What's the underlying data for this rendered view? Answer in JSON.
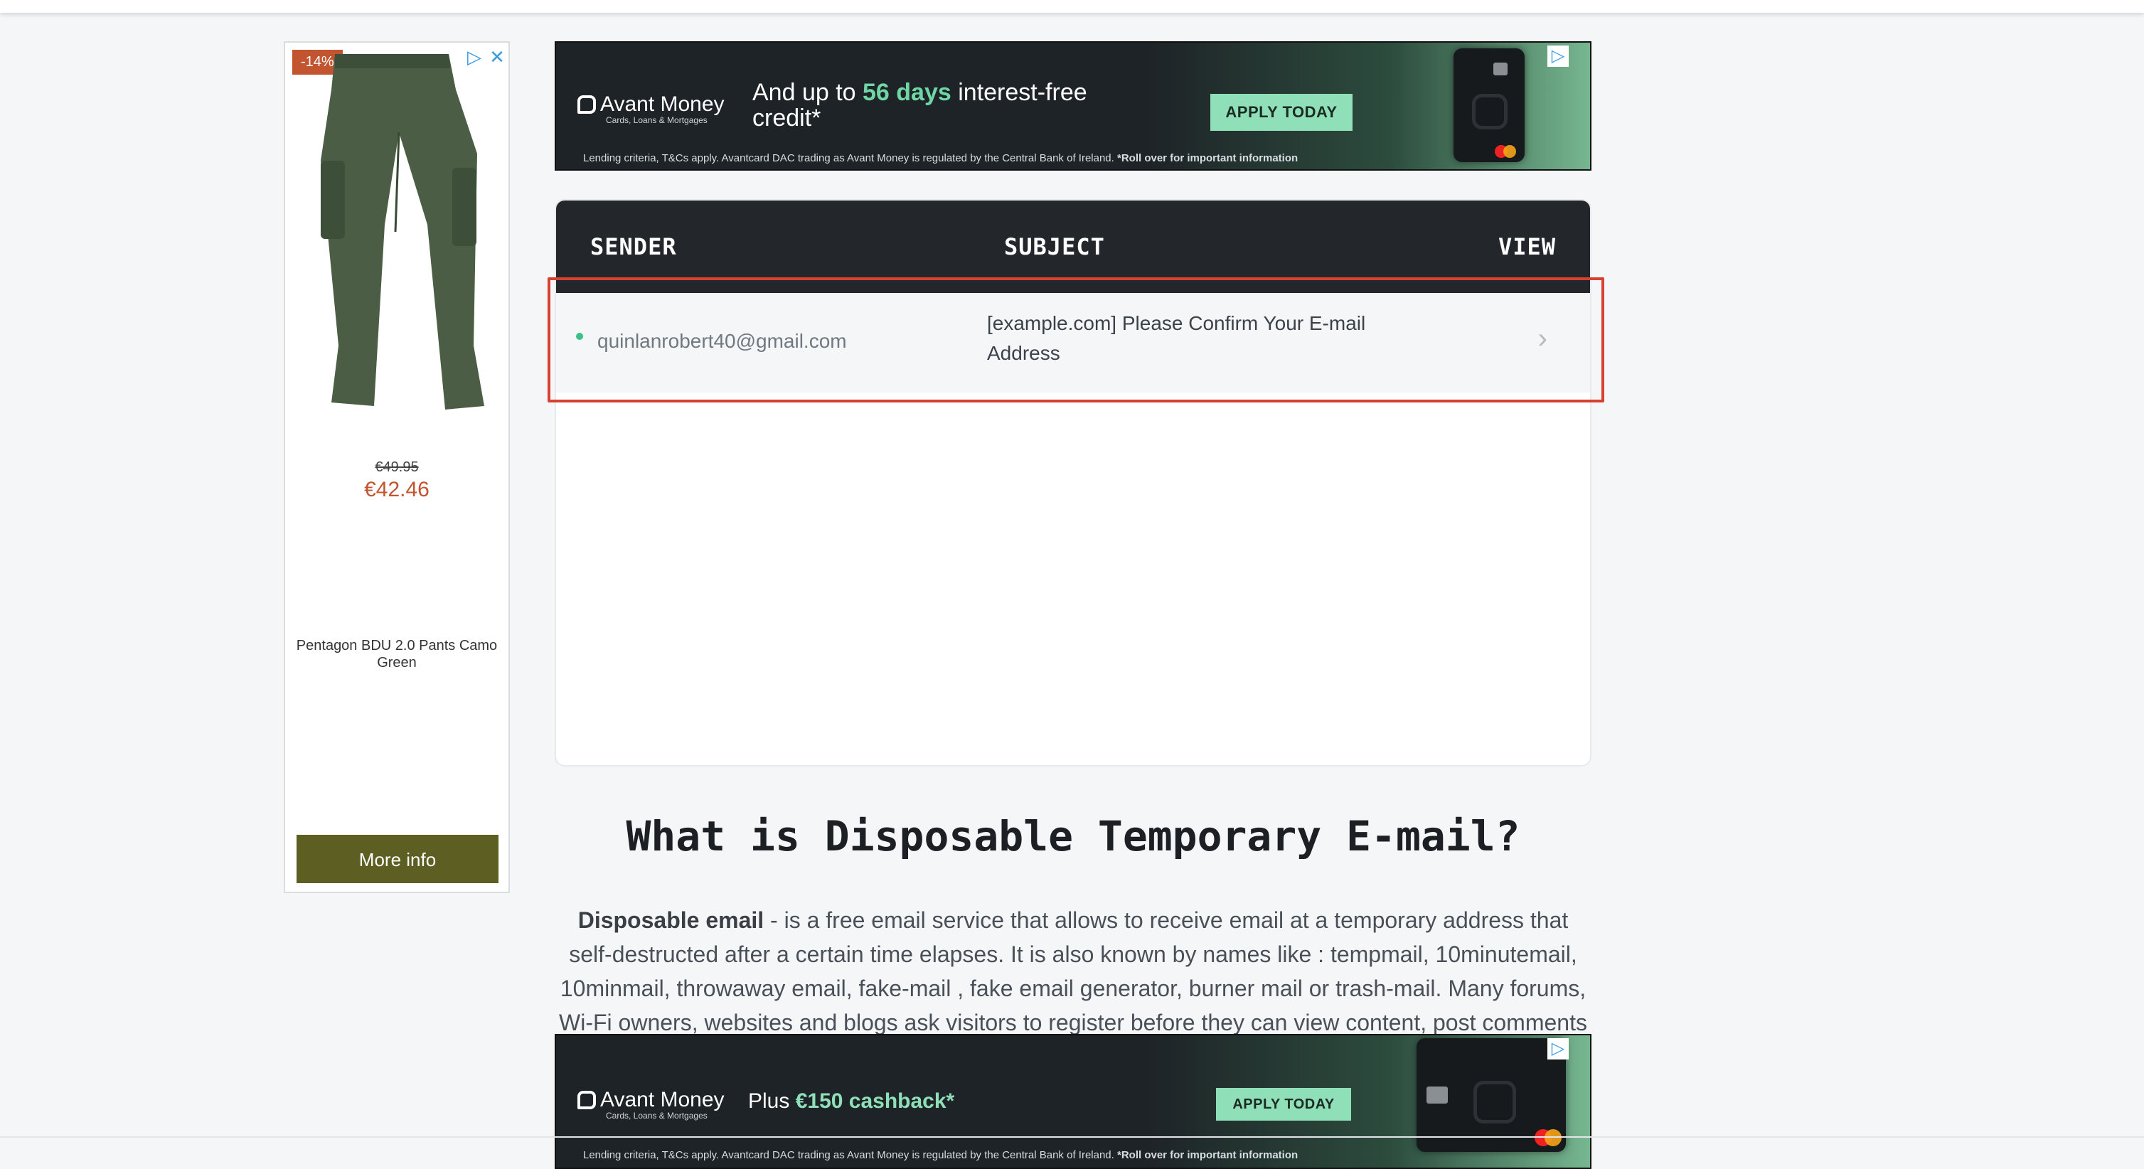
{
  "product_ad": {
    "discount": "-14%",
    "old_price": "€49.95",
    "new_price": "€42.46",
    "product_name": "Pentagon BDU 2.0 Pants Camo Green",
    "button": "More info"
  },
  "top_banner": {
    "brand": "Avant Money",
    "brand_tag": "Cards, Loans & Mortgages",
    "headline_pre": "And up to ",
    "headline_highlight": "56 days",
    "headline_post": " interest-free credit*",
    "button": "APPLY TODAY",
    "disclaimer_pre": "Lending criteria, T&Cs apply. Avantcard DAC trading as Avant Money is regulated by the Central Bank of Ireland. ",
    "disclaimer_bold": "*Roll over for important information"
  },
  "bottom_banner": {
    "brand": "Avant Money",
    "brand_tag": "Cards, Loans & Mortgages",
    "headline_pre": "Plus ",
    "headline_highlight": "€150 cashback*",
    "button": "APPLY TODAY",
    "disclaimer_pre": "Lending criteria, T&Cs apply. Avantcard DAC trading as Avant Money is regulated by the Central Bank of Ireland.  ",
    "disclaimer_bold": "*Roll over for important information"
  },
  "inbox": {
    "columns": {
      "sender": "SENDER",
      "subject": "SUBJECT",
      "view": "VIEW"
    },
    "messages": [
      {
        "sender": "quinlanrobert40@gmail.com",
        "subject": "[example.com] Please Confirm Your E-mail Address"
      }
    ]
  },
  "info": {
    "title": "What is Disposable Temporary E-mail?",
    "lead_bold": "Disposable email",
    "text": " - is a free email service that allows to receive email at a temporary address that self-destructed after a certain time elapses. It is also known by names like : tempmail, 10minutemail, 10minmail, throwaway email, fake-mail , fake email generator, burner mail or trash-mail. Many forums, Wi-Fi owners, websites and blogs ask visitors to register before they can view content, post comments"
  },
  "colors": {
    "accent_green": "#3dbf8a",
    "highlight_red": "#d8412f",
    "header_dark": "#23262b"
  },
  "icons": {
    "ad_play": "adchoices-icon",
    "ad_close": "close-icon",
    "row_status": "unread-dot-icon",
    "row_open": "chevron-right-icon"
  }
}
